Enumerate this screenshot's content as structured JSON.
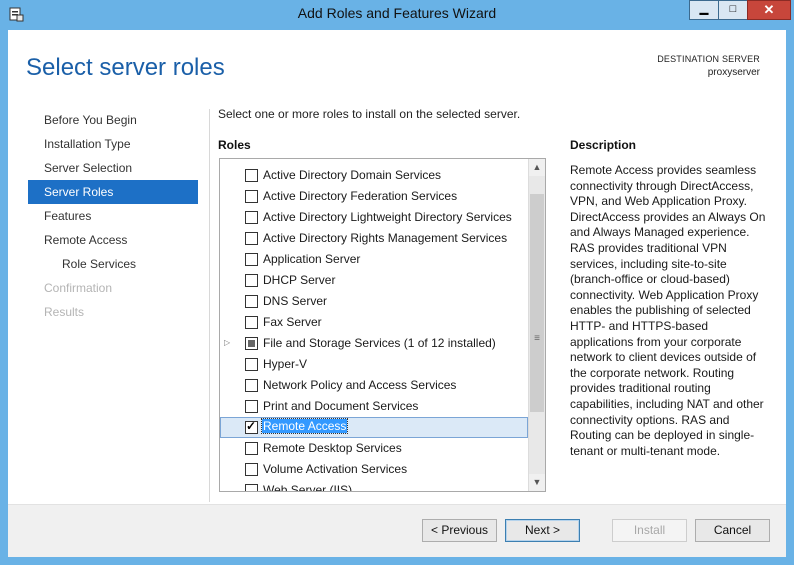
{
  "window": {
    "title": "Add Roles and Features Wizard",
    "controls": {
      "minimize": "▁",
      "maximize": "□",
      "close": "✕"
    }
  },
  "header": {
    "title": "Select server roles",
    "destination_label": "DESTINATION SERVER",
    "destination_server": "proxyserver"
  },
  "nav": {
    "items": [
      {
        "label": "Before You Begin",
        "state": "normal"
      },
      {
        "label": "Installation Type",
        "state": "normal"
      },
      {
        "label": "Server Selection",
        "state": "normal"
      },
      {
        "label": "Server Roles",
        "state": "active"
      },
      {
        "label": "Features",
        "state": "normal"
      },
      {
        "label": "Remote Access",
        "state": "normal"
      },
      {
        "label": "Role Services",
        "state": "sub"
      },
      {
        "label": "Confirmation",
        "state": "disabled"
      },
      {
        "label": "Results",
        "state": "disabled"
      }
    ]
  },
  "main": {
    "intro": "Select one or more roles to install on the selected server.",
    "roles_heading": "Roles",
    "description_heading": "Description",
    "roles": [
      {
        "label": "Active Directory Domain Services",
        "checked": false
      },
      {
        "label": "Active Directory Federation Services",
        "checked": false
      },
      {
        "label": "Active Directory Lightweight Directory Services",
        "checked": false
      },
      {
        "label": "Active Directory Rights Management Services",
        "checked": false
      },
      {
        "label": "Application Server",
        "checked": false
      },
      {
        "label": "DHCP Server",
        "checked": false
      },
      {
        "label": "DNS Server",
        "checked": false
      },
      {
        "label": "Fax Server",
        "checked": false
      },
      {
        "label": "File and Storage Services (1 of 12 installed)",
        "checked": "partial",
        "expandable": true
      },
      {
        "label": "Hyper-V",
        "checked": false
      },
      {
        "label": "Network Policy and Access Services",
        "checked": false
      },
      {
        "label": "Print and Document Services",
        "checked": false
      },
      {
        "label": "Remote Access",
        "checked": true,
        "selected": true
      },
      {
        "label": "Remote Desktop Services",
        "checked": false
      },
      {
        "label": "Volume Activation Services",
        "checked": false
      },
      {
        "label": "Web Server (IIS)",
        "checked": false
      }
    ],
    "description": "Remote Access provides seamless connectivity through DirectAccess, VPN, and Web Application Proxy. DirectAccess provides an Always On and Always Managed experience. RAS provides traditional VPN services, including site-to-site (branch-office or cloud-based) connectivity. Web Application Proxy enables the publishing of selected HTTP- and HTTPS-based applications from your corporate network to client devices outside of the corporate network. Routing provides traditional routing capabilities, including NAT and other connectivity options. RAS and Routing can be deployed in single-tenant or multi-tenant mode."
  },
  "footer": {
    "previous_label": "< Previous",
    "next_label": "Next >",
    "install_label": "Install",
    "cancel_label": "Cancel"
  }
}
